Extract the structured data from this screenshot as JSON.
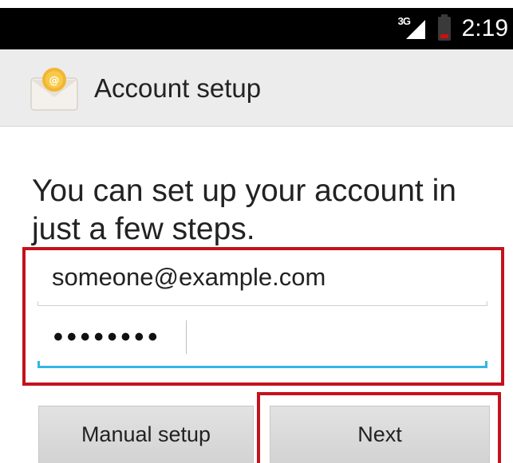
{
  "status_bar": {
    "network_type": "3G",
    "time": "2:19",
    "battery_level": 0.2,
    "battery_color": "#cc1010",
    "icons": [
      "signal-icon",
      "battery-icon"
    ]
  },
  "action_bar": {
    "title": "Account setup",
    "icon": "email-app-icon",
    "background": "#ececec"
  },
  "main": {
    "intro": "You can set up your account in just a few steps.",
    "email_field": {
      "value": "someone@example.com"
    },
    "password_field": {
      "value": "••••••••"
    }
  },
  "buttons": {
    "manual_setup": "Manual setup",
    "next": "Next"
  },
  "colors": {
    "focus_accent": "#33b5e5",
    "highlight": "#c4121c"
  }
}
